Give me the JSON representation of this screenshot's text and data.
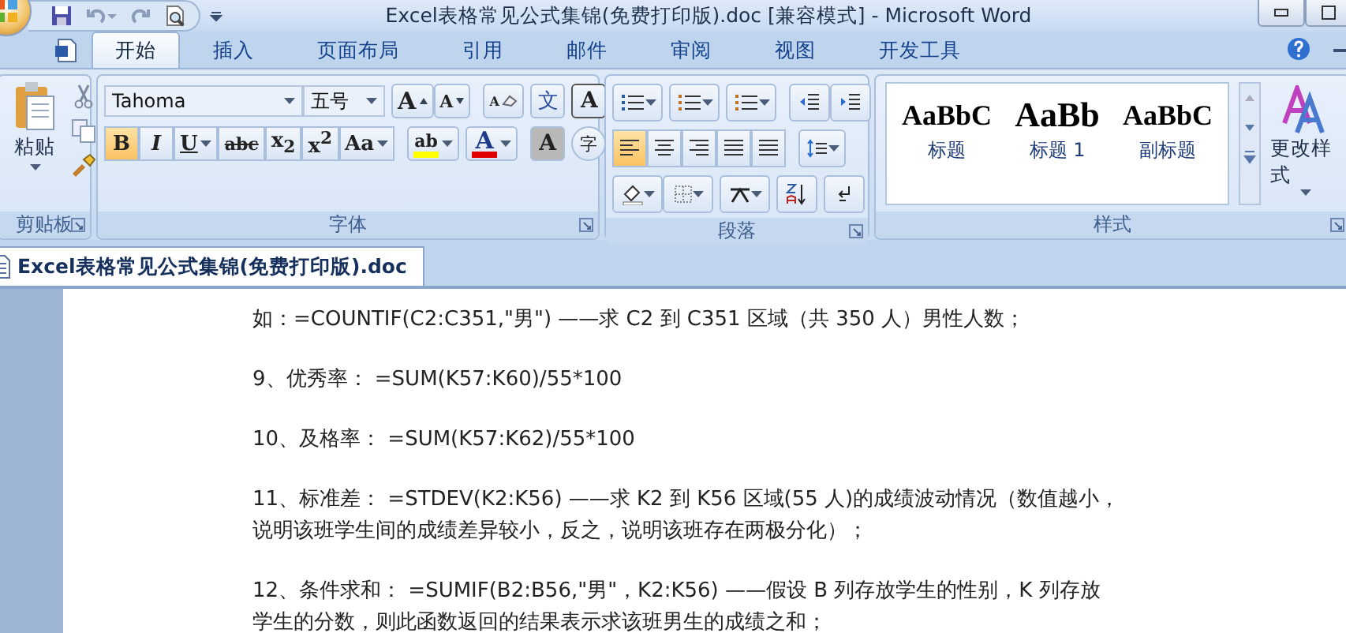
{
  "window": {
    "title": "Excel表格常见公式集锦(免费打印版).doc [兼容模式] - Microsoft Word"
  },
  "tabs": [
    {
      "label": "开始",
      "selected": true
    },
    {
      "label": "插入",
      "selected": false
    },
    {
      "label": "页面布局",
      "selected": false
    },
    {
      "label": "引用",
      "selected": false
    },
    {
      "label": "邮件",
      "selected": false
    },
    {
      "label": "审阅",
      "selected": false
    },
    {
      "label": "视图",
      "selected": false
    },
    {
      "label": "开发工具",
      "selected": false
    }
  ],
  "clipboard": {
    "paste_label": "粘贴",
    "group_label": "剪贴板"
  },
  "font": {
    "font_name": "Tahoma",
    "font_size": "五号",
    "group_label": "字体",
    "row1": [
      {
        "kind": "grow",
        "label": "A"
      },
      {
        "kind": "shrink",
        "label": "A"
      },
      {
        "kind": "clear",
        "label": "A"
      },
      {
        "kind": "phonetic",
        "label": "文"
      },
      {
        "kind": "border",
        "label": "A"
      }
    ],
    "row2": [
      {
        "kind": "bold",
        "label": "B",
        "selected": true
      },
      {
        "kind": "italic",
        "label": "I",
        "selected": false
      },
      {
        "kind": "underline",
        "label": "U",
        "selected": false
      },
      {
        "kind": "strike",
        "label": "abc",
        "selected": false
      },
      {
        "kind": "sub",
        "label": "x$_{2}$",
        "selected": false
      },
      {
        "kind": "sup",
        "label": "x$^{2}$",
        "selected": false
      },
      {
        "kind": "case",
        "label": "Aa",
        "selected": false
      }
    ],
    "row2b": [
      {
        "kind": "highlight",
        "label": "ab",
        "color": "#ffff00"
      },
      {
        "kind": "fontcolor",
        "label": "A",
        "color": "#e00000"
      },
      {
        "kind": "shade",
        "label": "A"
      },
      {
        "kind": "enclose",
        "label": "字"
      }
    ]
  },
  "paragraph": {
    "group_label": "段落",
    "align": [
      {
        "selected": true
      },
      {
        "selected": false
      },
      {
        "selected": false
      },
      {
        "selected": false
      },
      {
        "selected": false
      }
    ]
  },
  "styles": {
    "group_label": "样式",
    "items": [
      {
        "preview": "AaBbC",
        "name": "标题"
      },
      {
        "preview": "AaBb",
        "name": "标题 1"
      },
      {
        "preview": "AaBbC",
        "name": "副标题"
      }
    ],
    "change_label": "更改样式"
  },
  "document_tab": {
    "label": "Excel表格常见公式集锦(免费打印版).doc"
  },
  "paragraphs": [
    {
      "lines": [
        "如：=COUNTIF(C2:C351,\"男\") ——求 C2 到 C351 区域（共 350 人）男性人数；"
      ]
    },
    {
      "lines": [
        "9、优秀率： =SUM(K57:K60)/55*100"
      ]
    },
    {
      "lines": [
        "10、及格率： =SUM(K57:K62)/55*100"
      ]
    },
    {
      "lines": [
        "11、标准差： =STDEV(K2:K56) ——求 K2 到 K56 区域(55 人)的成绩波动情况（数值越小，",
        "说明该班学生间的成绩差异较小，反之，说明该班存在两极分化）；"
      ]
    },
    {
      "lines": [
        "12、条件求和： =SUMIF(B2:B56,\"男\"，K2:K56) ——假设 B 列存放学生的性别，K 列存放",
        "学生的分数，则此函数返回的结果表示求该班男生的成绩之和；"
      ]
    }
  ]
}
